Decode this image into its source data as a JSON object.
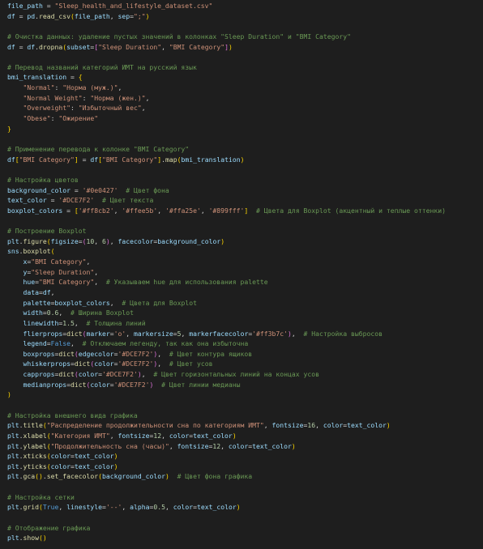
{
  "editor": {
    "background": "#1e1e1e",
    "token_colors": {
      "var": "#9cdcfe",
      "str": "#ce9178",
      "com": "#6a9955",
      "fn": "#dcdcaa",
      "kw": "#569cd6",
      "num": "#b5cea8",
      "brk1": "#ffd700",
      "brk2": "#da70d6",
      "brk3": "#179fff",
      "op": "#d4d4d4",
      "plain": "#d4d4d4"
    },
    "lines": [
      [
        [
          "var",
          "file_path"
        ],
        [
          "op",
          " = "
        ],
        [
          "str",
          "\"Sleep_health_and_lifestyle_dataset.csv\""
        ]
      ],
      [
        [
          "var",
          "df"
        ],
        [
          "op",
          " = "
        ],
        [
          "var",
          "pd"
        ],
        [
          "op",
          "."
        ],
        [
          "fn",
          "read_csv"
        ],
        [
          "brk1",
          "("
        ],
        [
          "var",
          "file_path"
        ],
        [
          "op",
          ", "
        ],
        [
          "var",
          "sep"
        ],
        [
          "op",
          "="
        ],
        [
          "str",
          "\";\""
        ],
        [
          "brk1",
          ")"
        ]
      ],
      [],
      [
        [
          "com",
          "# Очистка данных: удаление пустых значений в колонках \"Sleep Duration\" и \"BMI Category\""
        ]
      ],
      [
        [
          "var",
          "df"
        ],
        [
          "op",
          " = "
        ],
        [
          "var",
          "df"
        ],
        [
          "op",
          "."
        ],
        [
          "fn",
          "dropna"
        ],
        [
          "brk1",
          "("
        ],
        [
          "var",
          "subset"
        ],
        [
          "op",
          "="
        ],
        [
          "brk2",
          "["
        ],
        [
          "str",
          "\"Sleep Duration\""
        ],
        [
          "op",
          ", "
        ],
        [
          "str",
          "\"BMI Category\""
        ],
        [
          "brk2",
          "]"
        ],
        [
          "brk1",
          ")"
        ]
      ],
      [],
      [
        [
          "com",
          "# Перевод названий категорий ИМТ на русский язык"
        ]
      ],
      [
        [
          "var",
          "bmi_translation"
        ],
        [
          "op",
          " = "
        ],
        [
          "brk1",
          "{"
        ]
      ],
      [
        [
          "plain",
          "    "
        ],
        [
          "str",
          "\"Normal\""
        ],
        [
          "op",
          ": "
        ],
        [
          "str",
          "\"Норма (муж.)\""
        ],
        [
          "op",
          ","
        ]
      ],
      [
        [
          "plain",
          "    "
        ],
        [
          "str",
          "\"Normal Weight\""
        ],
        [
          "op",
          ": "
        ],
        [
          "str",
          "\"Норма (жен.)\""
        ],
        [
          "op",
          ","
        ]
      ],
      [
        [
          "plain",
          "    "
        ],
        [
          "str",
          "\"Overweight\""
        ],
        [
          "op",
          ": "
        ],
        [
          "str",
          "\"Избыточный вес\""
        ],
        [
          "op",
          ","
        ]
      ],
      [
        [
          "plain",
          "    "
        ],
        [
          "str",
          "\"Obese\""
        ],
        [
          "op",
          ": "
        ],
        [
          "str",
          "\"Ожирение\""
        ]
      ],
      [
        [
          "brk1",
          "}"
        ]
      ],
      [],
      [
        [
          "com",
          "# Применение перевода к колонке \"BMI Category\""
        ]
      ],
      [
        [
          "var",
          "df"
        ],
        [
          "brk1",
          "["
        ],
        [
          "str",
          "\"BMI Category\""
        ],
        [
          "brk1",
          "]"
        ],
        [
          "op",
          " = "
        ],
        [
          "var",
          "df"
        ],
        [
          "brk1",
          "["
        ],
        [
          "str",
          "\"BMI Category\""
        ],
        [
          "brk1",
          "]"
        ],
        [
          "op",
          "."
        ],
        [
          "fn",
          "map"
        ],
        [
          "brk1",
          "("
        ],
        [
          "var",
          "bmi_translation"
        ],
        [
          "brk1",
          ")"
        ]
      ],
      [],
      [
        [
          "com",
          "# Настройка цветов"
        ]
      ],
      [
        [
          "var",
          "background_color"
        ],
        [
          "op",
          " = "
        ],
        [
          "str",
          "'#0e0427'"
        ],
        [
          "plain",
          "  "
        ],
        [
          "com",
          "# Цвет фона"
        ]
      ],
      [
        [
          "var",
          "text_color"
        ],
        [
          "op",
          " = "
        ],
        [
          "str",
          "'#DCE7F2'"
        ],
        [
          "plain",
          "  "
        ],
        [
          "com",
          "# Цвет текста"
        ]
      ],
      [
        [
          "var",
          "boxplot_colors"
        ],
        [
          "op",
          " = "
        ],
        [
          "brk1",
          "["
        ],
        [
          "str",
          "'#ff8cb2'"
        ],
        [
          "op",
          ", "
        ],
        [
          "str",
          "'#ffee5b'"
        ],
        [
          "op",
          ", "
        ],
        [
          "str",
          "'#ffa25e'"
        ],
        [
          "op",
          ", "
        ],
        [
          "str",
          "'#899fff'"
        ],
        [
          "brk1",
          "]"
        ],
        [
          "plain",
          "  "
        ],
        [
          "com",
          "# Цвета для Boxplot (акцентный и теплые оттенки)"
        ]
      ],
      [],
      [
        [
          "com",
          "# Построение Boxplot"
        ]
      ],
      [
        [
          "var",
          "plt"
        ],
        [
          "op",
          "."
        ],
        [
          "fn",
          "figure"
        ],
        [
          "brk1",
          "("
        ],
        [
          "var",
          "figsize"
        ],
        [
          "op",
          "="
        ],
        [
          "brk2",
          "("
        ],
        [
          "num",
          "10"
        ],
        [
          "op",
          ", "
        ],
        [
          "num",
          "6"
        ],
        [
          "brk2",
          ")"
        ],
        [
          "op",
          ", "
        ],
        [
          "var",
          "facecolor"
        ],
        [
          "op",
          "="
        ],
        [
          "var",
          "background_color"
        ],
        [
          "brk1",
          ")"
        ]
      ],
      [
        [
          "var",
          "sns"
        ],
        [
          "op",
          "."
        ],
        [
          "fn",
          "boxplot"
        ],
        [
          "brk1",
          "("
        ]
      ],
      [
        [
          "plain",
          "    "
        ],
        [
          "var",
          "x"
        ],
        [
          "op",
          "="
        ],
        [
          "str",
          "\"BMI Category\""
        ],
        [
          "op",
          ","
        ]
      ],
      [
        [
          "plain",
          "    "
        ],
        [
          "var",
          "y"
        ],
        [
          "op",
          "="
        ],
        [
          "str",
          "\"Sleep Duration\""
        ],
        [
          "op",
          ","
        ]
      ],
      [
        [
          "plain",
          "    "
        ],
        [
          "var",
          "hue"
        ],
        [
          "op",
          "="
        ],
        [
          "str",
          "\"BMI Category\""
        ],
        [
          "op",
          ","
        ],
        [
          "plain",
          "  "
        ],
        [
          "com",
          "# Указываем hue для использования palette"
        ]
      ],
      [
        [
          "plain",
          "    "
        ],
        [
          "var",
          "data"
        ],
        [
          "op",
          "="
        ],
        [
          "var",
          "df"
        ],
        [
          "op",
          ","
        ]
      ],
      [
        [
          "plain",
          "    "
        ],
        [
          "var",
          "palette"
        ],
        [
          "op",
          "="
        ],
        [
          "var",
          "boxplot_colors"
        ],
        [
          "op",
          ","
        ],
        [
          "plain",
          "  "
        ],
        [
          "com",
          "# Цвета для Boxplot"
        ]
      ],
      [
        [
          "plain",
          "    "
        ],
        [
          "var",
          "width"
        ],
        [
          "op",
          "="
        ],
        [
          "num",
          "0.6"
        ],
        [
          "op",
          ","
        ],
        [
          "plain",
          "  "
        ],
        [
          "com",
          "# Ширина Boxplot"
        ]
      ],
      [
        [
          "plain",
          "    "
        ],
        [
          "var",
          "linewidth"
        ],
        [
          "op",
          "="
        ],
        [
          "num",
          "1.5"
        ],
        [
          "op",
          ","
        ],
        [
          "plain",
          "  "
        ],
        [
          "com",
          "# Толщина линий"
        ]
      ],
      [
        [
          "plain",
          "    "
        ],
        [
          "var",
          "flierprops"
        ],
        [
          "op",
          "="
        ],
        [
          "fn",
          "dict"
        ],
        [
          "brk2",
          "("
        ],
        [
          "var",
          "marker"
        ],
        [
          "op",
          "="
        ],
        [
          "str",
          "'o'"
        ],
        [
          "op",
          ", "
        ],
        [
          "var",
          "markersize"
        ],
        [
          "op",
          "="
        ],
        [
          "num",
          "5"
        ],
        [
          "op",
          ", "
        ],
        [
          "var",
          "markerfacecolor"
        ],
        [
          "op",
          "="
        ],
        [
          "str",
          "'#ff3b7c'"
        ],
        [
          "brk2",
          ")"
        ],
        [
          "op",
          ","
        ],
        [
          "plain",
          "  "
        ],
        [
          "com",
          "# Настройка выбросов"
        ]
      ],
      [
        [
          "plain",
          "    "
        ],
        [
          "var",
          "legend"
        ],
        [
          "op",
          "="
        ],
        [
          "kw",
          "False"
        ],
        [
          "op",
          ","
        ],
        [
          "plain",
          "  "
        ],
        [
          "com",
          "# Отключаем легенду, так как она избыточна"
        ]
      ],
      [
        [
          "plain",
          "    "
        ],
        [
          "var",
          "boxprops"
        ],
        [
          "op",
          "="
        ],
        [
          "fn",
          "dict"
        ],
        [
          "brk2",
          "("
        ],
        [
          "var",
          "edgecolor"
        ],
        [
          "op",
          "="
        ],
        [
          "str",
          "'#DCE7F2'"
        ],
        [
          "brk2",
          ")"
        ],
        [
          "op",
          ","
        ],
        [
          "plain",
          "  "
        ],
        [
          "com",
          "# Цвет контура ящиков"
        ]
      ],
      [
        [
          "plain",
          "    "
        ],
        [
          "var",
          "whiskerprops"
        ],
        [
          "op",
          "="
        ],
        [
          "fn",
          "dict"
        ],
        [
          "brk2",
          "("
        ],
        [
          "var",
          "color"
        ],
        [
          "op",
          "="
        ],
        [
          "str",
          "'#DCE7F2'"
        ],
        [
          "brk2",
          ")"
        ],
        [
          "op",
          ","
        ],
        [
          "plain",
          "  "
        ],
        [
          "com",
          "# Цвет усов"
        ]
      ],
      [
        [
          "plain",
          "    "
        ],
        [
          "var",
          "capprops"
        ],
        [
          "op",
          "="
        ],
        [
          "fn",
          "dict"
        ],
        [
          "brk2",
          "("
        ],
        [
          "var",
          "color"
        ],
        [
          "op",
          "="
        ],
        [
          "str",
          "'#DCE7F2'"
        ],
        [
          "brk2",
          ")"
        ],
        [
          "op",
          ","
        ],
        [
          "plain",
          "  "
        ],
        [
          "com",
          "# Цвет горизонтальных линий на концах усов"
        ]
      ],
      [
        [
          "plain",
          "    "
        ],
        [
          "var",
          "medianprops"
        ],
        [
          "op",
          "="
        ],
        [
          "fn",
          "dict"
        ],
        [
          "brk2",
          "("
        ],
        [
          "var",
          "color"
        ],
        [
          "op",
          "="
        ],
        [
          "str",
          "'#DCE7F2'"
        ],
        [
          "brk2",
          ")"
        ],
        [
          "plain",
          "  "
        ],
        [
          "com",
          "# Цвет линии медианы"
        ]
      ],
      [
        [
          "brk1",
          ")"
        ]
      ],
      [],
      [
        [
          "com",
          "# Настройка внешнего вида графика"
        ]
      ],
      [
        [
          "var",
          "plt"
        ],
        [
          "op",
          "."
        ],
        [
          "fn",
          "title"
        ],
        [
          "brk1",
          "("
        ],
        [
          "str",
          "\"Распределение продолжительности сна по категориям ИМТ\""
        ],
        [
          "op",
          ", "
        ],
        [
          "var",
          "fontsize"
        ],
        [
          "op",
          "="
        ],
        [
          "num",
          "16"
        ],
        [
          "op",
          ", "
        ],
        [
          "var",
          "color"
        ],
        [
          "op",
          "="
        ],
        [
          "var",
          "text_color"
        ],
        [
          "brk1",
          ")"
        ]
      ],
      [
        [
          "var",
          "plt"
        ],
        [
          "op",
          "."
        ],
        [
          "fn",
          "xlabel"
        ],
        [
          "brk1",
          "("
        ],
        [
          "str",
          "\"Категория ИМТ\""
        ],
        [
          "op",
          ", "
        ],
        [
          "var",
          "fontsize"
        ],
        [
          "op",
          "="
        ],
        [
          "num",
          "12"
        ],
        [
          "op",
          ", "
        ],
        [
          "var",
          "color"
        ],
        [
          "op",
          "="
        ],
        [
          "var",
          "text_color"
        ],
        [
          "brk1",
          ")"
        ]
      ],
      [
        [
          "var",
          "plt"
        ],
        [
          "op",
          "."
        ],
        [
          "fn",
          "ylabel"
        ],
        [
          "brk1",
          "("
        ],
        [
          "str",
          "\"Продолжительность сна (часы)\""
        ],
        [
          "op",
          ", "
        ],
        [
          "var",
          "fontsize"
        ],
        [
          "op",
          "="
        ],
        [
          "num",
          "12"
        ],
        [
          "op",
          ", "
        ],
        [
          "var",
          "color"
        ],
        [
          "op",
          "="
        ],
        [
          "var",
          "text_color"
        ],
        [
          "brk1",
          ")"
        ]
      ],
      [
        [
          "var",
          "plt"
        ],
        [
          "op",
          "."
        ],
        [
          "fn",
          "xticks"
        ],
        [
          "brk1",
          "("
        ],
        [
          "var",
          "color"
        ],
        [
          "op",
          "="
        ],
        [
          "var",
          "text_color"
        ],
        [
          "brk1",
          ")"
        ]
      ],
      [
        [
          "var",
          "plt"
        ],
        [
          "op",
          "."
        ],
        [
          "fn",
          "yticks"
        ],
        [
          "brk1",
          "("
        ],
        [
          "var",
          "color"
        ],
        [
          "op",
          "="
        ],
        [
          "var",
          "text_color"
        ],
        [
          "brk1",
          ")"
        ]
      ],
      [
        [
          "var",
          "plt"
        ],
        [
          "op",
          "."
        ],
        [
          "fn",
          "gca"
        ],
        [
          "brk1",
          "("
        ],
        [
          "brk1",
          ")"
        ],
        [
          "op",
          "."
        ],
        [
          "fn",
          "set_facecolor"
        ],
        [
          "brk1",
          "("
        ],
        [
          "var",
          "background_color"
        ],
        [
          "brk1",
          ")"
        ],
        [
          "plain",
          "  "
        ],
        [
          "com",
          "# Цвет фона графика"
        ]
      ],
      [],
      [
        [
          "com",
          "# Настройка сетки"
        ]
      ],
      [
        [
          "var",
          "plt"
        ],
        [
          "op",
          "."
        ],
        [
          "fn",
          "grid"
        ],
        [
          "brk1",
          "("
        ],
        [
          "kw",
          "True"
        ],
        [
          "op",
          ", "
        ],
        [
          "var",
          "linestyle"
        ],
        [
          "op",
          "="
        ],
        [
          "str",
          "'--'"
        ],
        [
          "op",
          ", "
        ],
        [
          "var",
          "alpha"
        ],
        [
          "op",
          "="
        ],
        [
          "num",
          "0.5"
        ],
        [
          "op",
          ", "
        ],
        [
          "var",
          "color"
        ],
        [
          "op",
          "="
        ],
        [
          "var",
          "text_color"
        ],
        [
          "brk1",
          ")"
        ]
      ],
      [],
      [
        [
          "com",
          "# Отображение графика"
        ]
      ],
      [
        [
          "var",
          "plt"
        ],
        [
          "op",
          "."
        ],
        [
          "fn",
          "show"
        ],
        [
          "brk1",
          "("
        ],
        [
          "brk1",
          ")"
        ]
      ]
    ]
  }
}
